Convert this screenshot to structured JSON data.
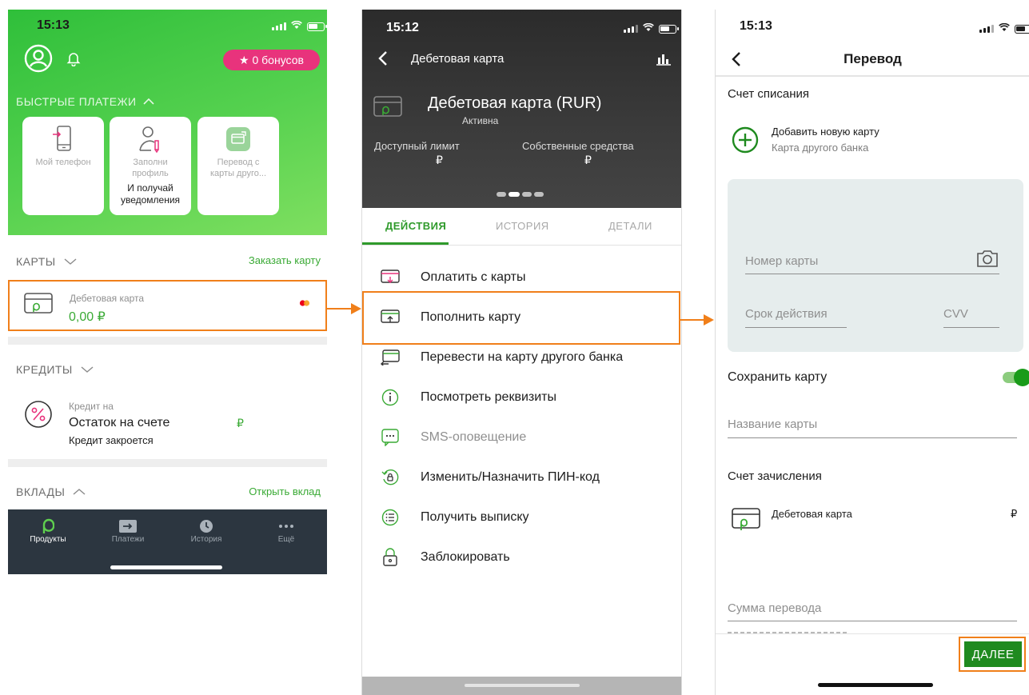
{
  "screen1": {
    "status": {
      "time": "15:13"
    },
    "header": {
      "bonus_label": "★ 0 бонусов"
    },
    "quick_payments": {
      "title": "БЫСТРЫЕ ПЛАТЕЖИ",
      "cards": [
        {
          "label": "Мой телефон",
          "sub": ""
        },
        {
          "label": "Заполни профиль",
          "sub": "И получай уведомления"
        },
        {
          "label": "Перевод с карты друго...",
          "sub": ""
        }
      ]
    },
    "cards_section": {
      "title": "КАРТЫ",
      "link": "Заказать карту",
      "item": {
        "name": "Дебетовая карта",
        "balance": "0,00 ₽"
      }
    },
    "credits_section": {
      "title": "КРЕДИТЫ",
      "item": {
        "name": "Кредит на",
        "balance_label": "Остаток на счете",
        "currency": "₽",
        "note": "Кредит закроется"
      }
    },
    "deposits_section": {
      "title": "ВКЛАДЫ",
      "link": "Открыть вклад"
    },
    "bottom_nav": [
      {
        "label": "Продукты",
        "icon": "brand-icon",
        "active": true
      },
      {
        "label": "Платежи",
        "icon": "transfer-icon",
        "active": false
      },
      {
        "label": "История",
        "icon": "clock-icon",
        "active": false
      },
      {
        "label": "Ещё",
        "icon": "more-icon",
        "active": false
      }
    ]
  },
  "screen2": {
    "status": {
      "time": "15:12"
    },
    "header": {
      "title": "Дебетовая карта"
    },
    "card": {
      "name": "Дебетовая карта (RUR)",
      "state": "Активна",
      "available_label": "Доступный лимит",
      "available_value": "₽",
      "own_label": "Собственные средства",
      "own_value": "₽"
    },
    "tabs": [
      "ДЕЙСТВИЯ",
      "ИСТОРИЯ",
      "ДЕТАЛИ"
    ],
    "actions": [
      "Оплатить с карты",
      "Пополнить карту",
      "Перевести на карту другого банка",
      "Посмотреть реквизиты",
      "SMS-оповещение",
      "Изменить/Назначить ПИН-код",
      "Получить выписку",
      "Заблокировать"
    ]
  },
  "screen3": {
    "status": {
      "time": "15:13"
    },
    "header": {
      "title": "Перевод"
    },
    "source": {
      "title": "Счет списания",
      "add_card": "Добавить новую карту",
      "add_card_sub": "Карта другого банка"
    },
    "card_form": {
      "number_placeholder": "Номер карты",
      "expiry_placeholder": "Срок действия",
      "cvv_placeholder": "CVV"
    },
    "save_card_label": "Сохранить карту",
    "card_name_placeholder": "Название карты",
    "destination": {
      "title": "Счет зачисления",
      "card_name": "Дебетовая карта",
      "currency": "₽"
    },
    "amount_placeholder": "Сумма перевода",
    "next_button": "ДАЛЕЕ"
  },
  "colors": {
    "accent_green": "#3aaa35",
    "highlight_orange": "#f07f1a",
    "bonus_pink": "#e8337c",
    "nav_dark": "#2c3640"
  }
}
